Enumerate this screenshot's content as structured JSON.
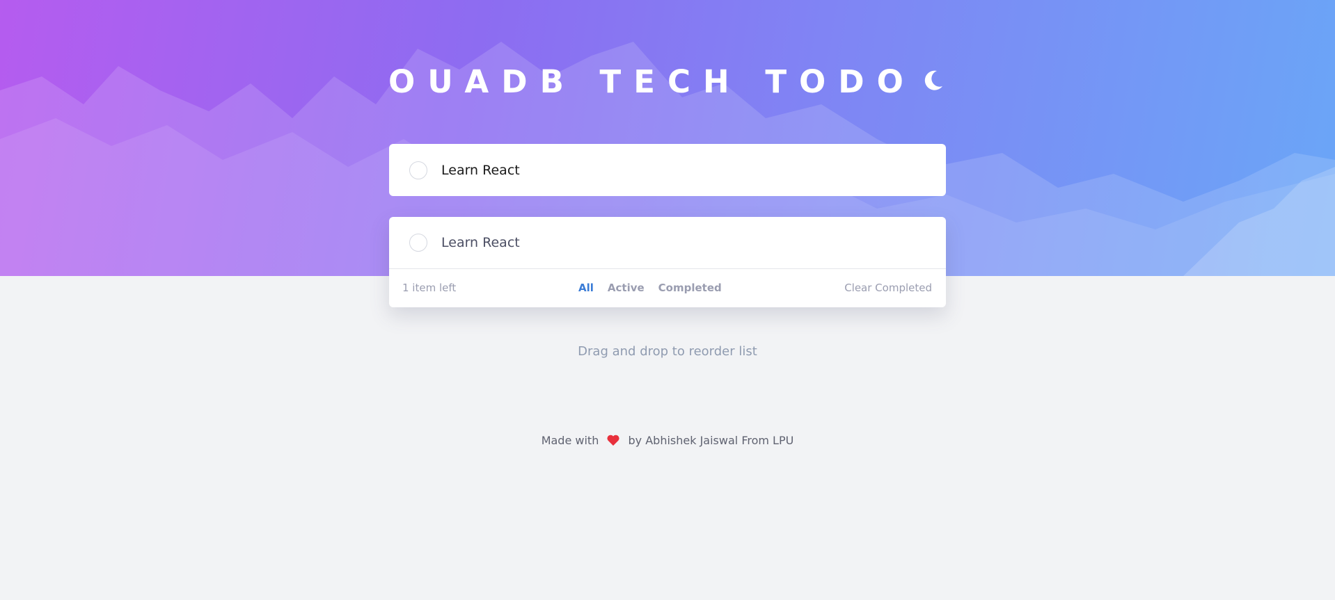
{
  "header": {
    "title": "OUADB TECH TODO",
    "theme_toggle_icon": "moon-icon"
  },
  "new_todo": {
    "value": "Learn React",
    "checkbox_icon": "circle-checkbox-icon"
  },
  "todos": [
    {
      "text": "Learn React",
      "completed": false
    }
  ],
  "footer": {
    "items_left": "1 item left",
    "filters": [
      "All",
      "Active",
      "Completed"
    ],
    "active_filter": "All",
    "clear_label": "Clear Completed"
  },
  "hint": "Drag and drop to reorder list",
  "credit": {
    "prefix": "Made with",
    "icon": "heart-icon",
    "suffix": "by Abhishek Jaiswal From LPU"
  },
  "colors": {
    "gradient_start": "#b55cef",
    "gradient_end": "#6aa6f7",
    "accent": "#3a7cd6",
    "page_background": "#f2f3f5"
  }
}
